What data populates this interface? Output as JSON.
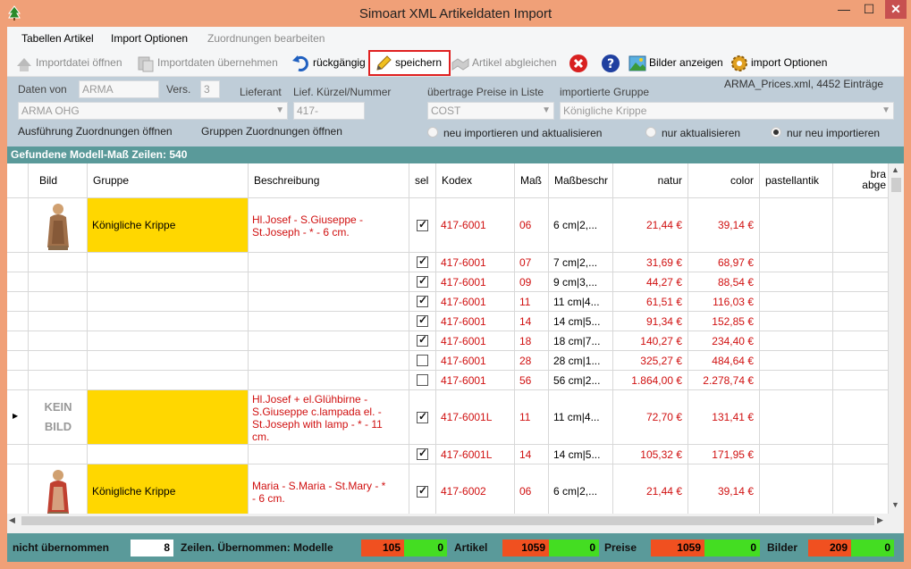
{
  "window": {
    "title": "Simoart XML Artikeldaten Import",
    "controls": {
      "minimize": "—",
      "maximize": "☐",
      "close": "✕"
    }
  },
  "menu": [
    {
      "label": "Tabellen Artikel",
      "enabled": true
    },
    {
      "label": "Import Optionen",
      "enabled": true
    },
    {
      "label": "Zuordnungen bearbeiten",
      "enabled": false
    }
  ],
  "toolbar": {
    "open_import": "Importdatei öffnen",
    "apply_import": "Importdaten übernehmen",
    "undo": "rückgängig",
    "save": "speichern",
    "match": "Artikel abgleichen",
    "show_images": "Bilder anzeigen",
    "import_options": "import Optionen"
  },
  "panel": {
    "daten_von_label": "Daten von",
    "daten_von_value": "ARMA",
    "vers_label": "Vers.",
    "vers_value": "3",
    "supplier_label": "Lieferant",
    "supplier_value": "ARMA OHG",
    "kuerzel_label": "Lief. Kürzel/Nummer",
    "kuerzel_value": "417-",
    "price_list_label": "übertrage Preise in Liste",
    "price_list_value": "COST",
    "group_label": "importierte Gruppe",
    "group_value": "Königliche Krippe",
    "file_info": "ARMA_Prices.xml, 4452 Einträge",
    "link_assign": "Ausführung Zuordnungen öffnen",
    "link_groups": "Gruppen Zuordnungen öffnen",
    "radio_new_update": "neu importieren und aktualisieren",
    "radio_update": "nur aktualisieren",
    "radio_new": "nur neu importieren",
    "radio_selected": "radio_new"
  },
  "found_label": "Gefundene Modell-Maß Zeilen: 540",
  "grid": {
    "headers": {
      "bild": "Bild",
      "gruppe": "Gruppe",
      "beschreibung": "Beschreibung",
      "sel": "sel",
      "kodex": "Kodex",
      "mass": "Maß",
      "massbeschr": "Maßbeschr",
      "natur": "natur",
      "color": "color",
      "pastell": "pastellantik",
      "bra1": "bra",
      "bra2": "abge"
    },
    "kein_bild": [
      "KEIN",
      "BILD"
    ],
    "rows": [
      {
        "group": "Königliche Krippe",
        "desc": [
          "Hl.Josef - S.Giuseppe -",
          "St.Joseph - * - 6 cm."
        ],
        "sel": true,
        "kodex": "417-6001",
        "mass": "06",
        "massbeschr": "6 cm|2,...",
        "natur": "21,44 €",
        "color": "39,14 €"
      },
      {
        "sel": true,
        "kodex": "417-6001",
        "mass": "07",
        "massbeschr": "7 cm|2,...",
        "natur": "31,69 €",
        "color": "68,97 €"
      },
      {
        "sel": true,
        "kodex": "417-6001",
        "mass": "09",
        "massbeschr": "9 cm|3,...",
        "natur": "44,27 €",
        "color": "88,54 €"
      },
      {
        "sel": true,
        "kodex": "417-6001",
        "mass": "11",
        "massbeschr": "11 cm|4...",
        "natur": "61,51 €",
        "color": "116,03 €"
      },
      {
        "sel": true,
        "kodex": "417-6001",
        "mass": "14",
        "massbeschr": "14 cm|5...",
        "natur": "91,34 €",
        "color": "152,85 €"
      },
      {
        "sel": true,
        "kodex": "417-6001",
        "mass": "18",
        "massbeschr": "18 cm|7...",
        "natur": "140,27 €",
        "color": "234,40 €"
      },
      {
        "sel": false,
        "kodex": "417-6001",
        "mass": "28",
        "massbeschr": "28 cm|1...",
        "natur": "325,27 €",
        "color": "484,64 €"
      },
      {
        "sel": false,
        "kodex": "417-6001",
        "mass": "56",
        "massbeschr": "56 cm|2...",
        "natur": "1.864,00 €",
        "color": "2.278,74 €"
      },
      {
        "group": "",
        "desc": [
          "Hl.Josef + el.Glühbirne -",
          "S.Giuseppe c.lampada el. -",
          "St.Joseph with lamp - * - 11",
          "cm."
        ],
        "sel": true,
        "kodex": "417-6001L",
        "mass": "11",
        "massbeschr": "11 cm|4...",
        "natur": "72,70 €",
        "color": "131,41 €"
      },
      {
        "sel": true,
        "kodex": "417-6001L",
        "mass": "14",
        "massbeschr": "14 cm|5...",
        "natur": "105,32 €",
        "color": "171,95 €"
      },
      {
        "group": "Königliche Krippe",
        "desc": [
          "Maria - S.Maria - St.Mary - *",
          "- 6 cm."
        ],
        "sel": true,
        "kodex": "417-6002",
        "mass": "06",
        "massbeschr": "6 cm|2,...",
        "natur": "21,44 €",
        "color": "39,14 €"
      }
    ]
  },
  "status": {
    "not_taken_label": "nicht übernommen",
    "not_taken_value": "8",
    "rows_label": "Zeilen. Übernommen: Modelle",
    "modelle_red": "105",
    "modelle_green": "0",
    "artikel_label": "Artikel",
    "artikel_red": "1059",
    "artikel_green": "0",
    "preise_label": "Preise",
    "preise_red": "1059",
    "preise_green": "0",
    "bilder_label": "Bilder",
    "bilder_red": "209",
    "bilder_green": "0"
  },
  "colors": {
    "title_bg": "#f0a078",
    "panel_bg": "#bfcdd8",
    "teal": "#5a9a9a",
    "group_yellow": "#ffd700",
    "value_red": "#d01010",
    "save_highlight": "#e02020"
  }
}
